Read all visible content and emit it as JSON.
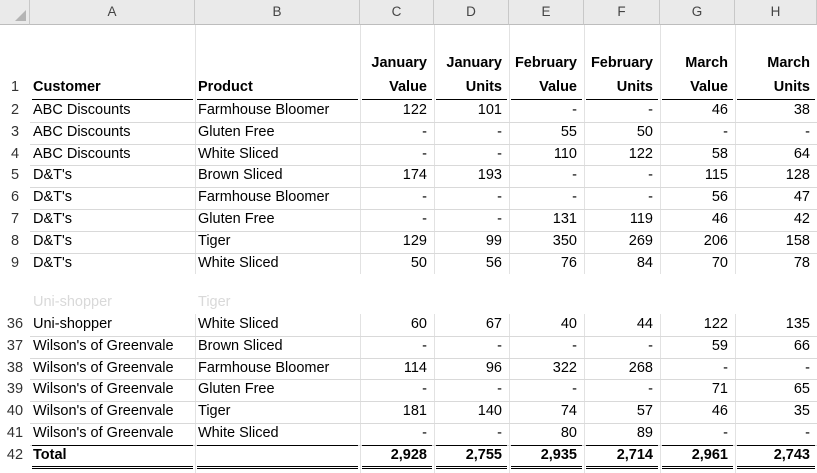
{
  "columns": [
    "A",
    "B",
    "C",
    "D",
    "E",
    "F",
    "G",
    "H"
  ],
  "header": {
    "row": "1",
    "customer": "Customer",
    "product": "Product",
    "jan_value": [
      "January",
      "Value"
    ],
    "jan_units": [
      "January",
      "Units"
    ],
    "feb_value": [
      "February",
      "Value"
    ],
    "feb_units": [
      "February",
      "Units"
    ],
    "mar_value": [
      "March",
      "Value"
    ],
    "mar_units": [
      "March",
      "Units"
    ]
  },
  "top_rows": [
    {
      "row": "2",
      "customer": "ABC Discounts",
      "product": "Farmhouse Bloomer",
      "c": "122",
      "d": "101",
      "e": "-",
      "f": "-",
      "g": "46",
      "h": "38"
    },
    {
      "row": "3",
      "customer": "ABC Discounts",
      "product": "Gluten Free",
      "c": "-",
      "d": "-",
      "e": "55",
      "f": "50",
      "g": "-",
      "h": "-"
    },
    {
      "row": "4",
      "customer": "ABC Discounts",
      "product": "White Sliced",
      "c": "-",
      "d": "-",
      "e": "110",
      "f": "122",
      "g": "58",
      "h": "64"
    },
    {
      "row": "5",
      "customer": "D&T's",
      "product": "Brown Sliced",
      "c": "174",
      "d": "193",
      "e": "-",
      "f": "-",
      "g": "115",
      "h": "128"
    },
    {
      "row": "6",
      "customer": "D&T's",
      "product": "Farmhouse Bloomer",
      "c": "-",
      "d": "-",
      "e": "-",
      "f": "-",
      "g": "56",
      "h": "47"
    },
    {
      "row": "7",
      "customer": "D&T's",
      "product": "Gluten Free",
      "c": "-",
      "d": "-",
      "e": "131",
      "f": "119",
      "g": "46",
      "h": "42"
    },
    {
      "row": "8",
      "customer": "D&T's",
      "product": "Tiger",
      "c": "129",
      "d": "99",
      "e": "350",
      "f": "269",
      "g": "206",
      "h": "158"
    },
    {
      "row": "9",
      "customer": "D&T's",
      "product": "White Sliced",
      "c": "50",
      "d": "56",
      "e": "76",
      "f": "84",
      "g": "70",
      "h": "78"
    }
  ],
  "ghost_row": {
    "customer": "Uni-shopper",
    "product": "Tiger"
  },
  "bottom_rows": [
    {
      "row": "36",
      "customer": "Uni-shopper",
      "product": "White Sliced",
      "c": "60",
      "d": "67",
      "e": "40",
      "f": "44",
      "g": "122",
      "h": "135"
    },
    {
      "row": "37",
      "customer": "Wilson's of Greenvale",
      "product": "Brown Sliced",
      "c": "-",
      "d": "-",
      "e": "-",
      "f": "-",
      "g": "59",
      "h": "66"
    },
    {
      "row": "38",
      "customer": "Wilson's of Greenvale",
      "product": "Farmhouse Bloomer",
      "c": "114",
      "d": "96",
      "e": "322",
      "f": "268",
      "g": "-",
      "h": "-"
    },
    {
      "row": "39",
      "customer": "Wilson's of Greenvale",
      "product": "Gluten Free",
      "c": "-",
      "d": "-",
      "e": "-",
      "f": "-",
      "g": "71",
      "h": "65"
    },
    {
      "row": "40",
      "customer": "Wilson's of Greenvale",
      "product": "Tiger",
      "c": "181",
      "d": "140",
      "e": "74",
      "f": "57",
      "g": "46",
      "h": "35"
    },
    {
      "row": "41",
      "customer": "Wilson's of Greenvale",
      "product": "White Sliced",
      "c": "-",
      "d": "-",
      "e": "80",
      "f": "89",
      "g": "-",
      "h": "-"
    }
  ],
  "total": {
    "row": "42",
    "label": "Total",
    "c": "2,928",
    "d": "2,755",
    "e": "2,935",
    "f": "2,714",
    "g": "2,961",
    "h": "2,743"
  }
}
